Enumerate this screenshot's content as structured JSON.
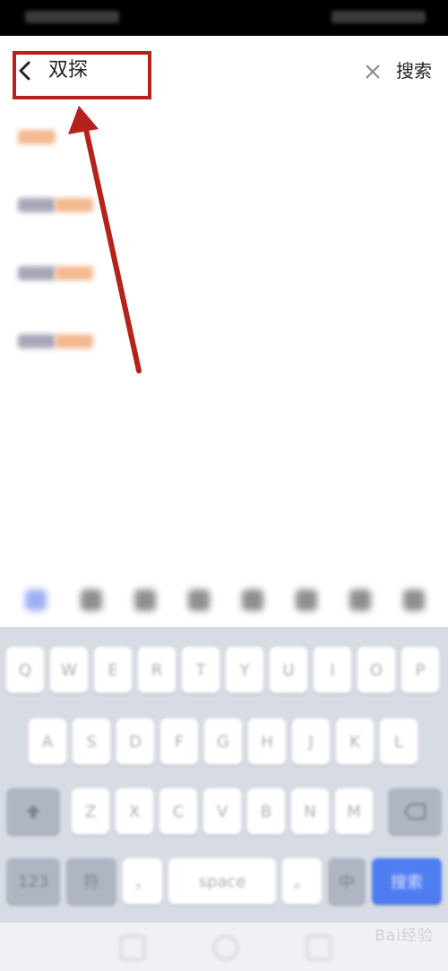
{
  "search": {
    "query": "双探",
    "search_label": "搜索"
  },
  "suggestions": [
    {
      "gray": "",
      "orange": "双探"
    },
    {
      "gray": "双探",
      "orange": "双探"
    },
    {
      "gray": "双探",
      "orange": "双探"
    },
    {
      "gray": "双探",
      "orange": "双探"
    }
  ],
  "keyboard": {
    "row1": [
      "Q",
      "W",
      "E",
      "R",
      "T",
      "Y",
      "U",
      "I",
      "O",
      "P"
    ],
    "row2": [
      "A",
      "S",
      "D",
      "F",
      "G",
      "H",
      "J",
      "K",
      "L"
    ],
    "row3": [
      "Z",
      "X",
      "C",
      "V",
      "B",
      "N",
      "M"
    ],
    "row4": [
      "123",
      "符",
      "，",
      "space",
      "。",
      "中",
      "搜索"
    ]
  },
  "watermark": "Bai经验",
  "colors": {
    "highlight_border": "#b5221b",
    "suggestion_orange": "#f3b98f",
    "enter_key": "#4f7cf1"
  }
}
